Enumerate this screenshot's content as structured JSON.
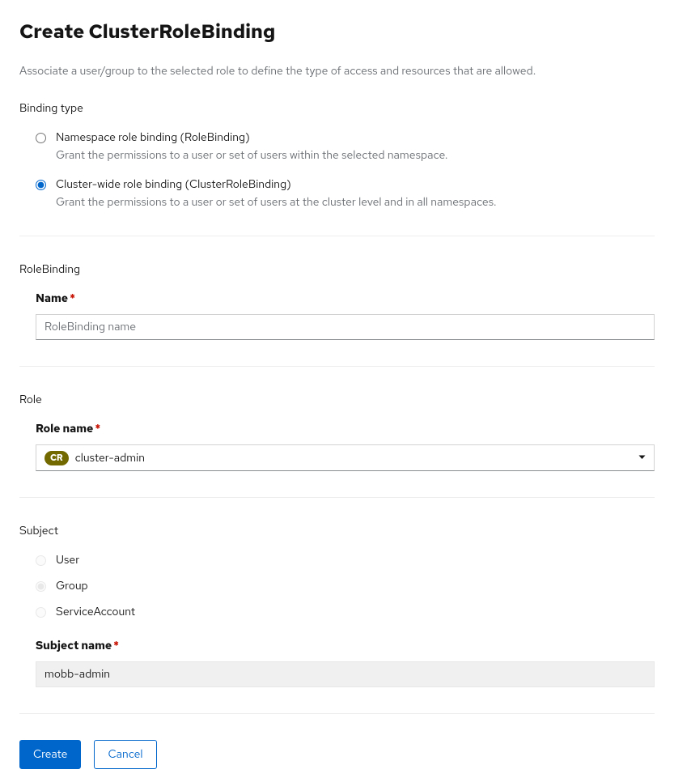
{
  "page": {
    "title": "Create ClusterRoleBinding",
    "description": "Associate a user/group to the selected role to define the type of access and resources that are allowed."
  },
  "bindingType": {
    "sectionLabel": "Binding type",
    "options": [
      {
        "title": "Namespace role binding (RoleBinding)",
        "desc": "Grant the permissions to a user or set of users within the selected namespace."
      },
      {
        "title": "Cluster-wide role binding (ClusterRoleBinding)",
        "desc": "Grant the permissions to a user or set of users at the cluster level and in all namespaces."
      }
    ]
  },
  "roleBinding": {
    "sectionLabel": "RoleBinding",
    "nameLabel": "Name",
    "namePlaceholder": "RoleBinding name",
    "nameValue": ""
  },
  "role": {
    "sectionLabel": "Role",
    "nameLabel": "Role name",
    "badge": "CR",
    "selected": "cluster-admin"
  },
  "subject": {
    "sectionLabel": "Subject",
    "options": [
      "User",
      "Group",
      "ServiceAccount"
    ],
    "nameLabel": "Subject name",
    "nameValue": "mobb-admin"
  },
  "actions": {
    "create": "Create",
    "cancel": "Cancel"
  },
  "required": "*"
}
